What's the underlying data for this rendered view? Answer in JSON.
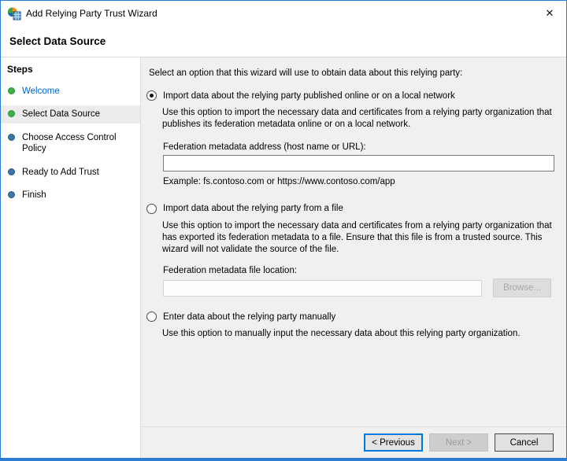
{
  "window": {
    "title": "Add Relying Party Trust Wizard",
    "close_glyph": "✕"
  },
  "header": {
    "title": "Select Data Source"
  },
  "sidebar": {
    "title": "Steps",
    "items": [
      {
        "label": "Welcome",
        "state": "completed-link"
      },
      {
        "label": "Select Data Source",
        "state": "current"
      },
      {
        "label": "Choose Access Control Policy",
        "state": "upcoming"
      },
      {
        "label": "Ready to Add Trust",
        "state": "upcoming"
      },
      {
        "label": "Finish",
        "state": "upcoming"
      }
    ]
  },
  "main": {
    "intro": "Select an option that this wizard will use to obtain data about this relying party:",
    "options": [
      {
        "label": "Import data about the relying party published online or on a local network",
        "selected": true,
        "description": "Use this option to import the necessary data and certificates from a relying party organization that publishes its federation metadata online or on a local network.",
        "field_label": "Federation metadata address (host name or URL):",
        "field_value": "",
        "example": "Example: fs.contoso.com or https://www.contoso.com/app"
      },
      {
        "label": "Import data about the relying party from a file",
        "selected": false,
        "description": "Use this option to import the necessary data and certificates from a relying party organization that has exported its federation metadata to a file. Ensure that this file is from a trusted source.  This wizard will not validate the source of the file.",
        "field_label": "Federation metadata file location:",
        "field_value": "",
        "field_disabled": true,
        "browse_label": "Browse..."
      },
      {
        "label": "Enter data about the relying party manually",
        "selected": false,
        "description": "Use this option to manually input the necessary data about this relying party organization."
      }
    ]
  },
  "footer": {
    "previous_label": "< Previous",
    "next_label": "Next >",
    "next_disabled": true,
    "cancel_label": "Cancel"
  },
  "colors": {
    "window_border": "#2b7cd3",
    "accent_focus": "#0078d7",
    "content_bg": "#f0f0f0",
    "sidebar_bg": "#ffffff",
    "step_done_bullet": "#3fae49",
    "step_upcoming_bullet": "#3d75a3",
    "link_blue": "#0066cc"
  }
}
